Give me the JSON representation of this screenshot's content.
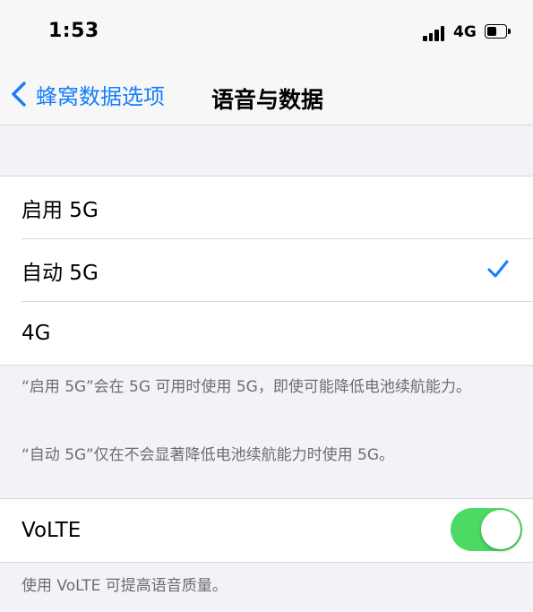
{
  "status_bar": {
    "time": "1:53",
    "network": "4G",
    "battery_level": 0.55
  },
  "nav": {
    "back_label": "蜂窝数据选项",
    "title": "语音与数据"
  },
  "options": [
    {
      "label": "启用 5G",
      "selected": false
    },
    {
      "label": "自动 5G",
      "selected": true
    },
    {
      "label": "4G",
      "selected": false
    }
  ],
  "notes": {
    "note1": "“启用 5G”会在 5G 可用时使用 5G，即使可能降低电池续航能力。",
    "note2": "“自动 5G”仅在不会显著降低电池续航能力时使用 5G。"
  },
  "volte": {
    "label": "VoLTE",
    "enabled": true,
    "footer": "使用 VoLTE 可提高语音质量。"
  },
  "colors": {
    "accent": "#147efb",
    "toggle_on": "#4cd964",
    "background": "#f2f2f7"
  }
}
